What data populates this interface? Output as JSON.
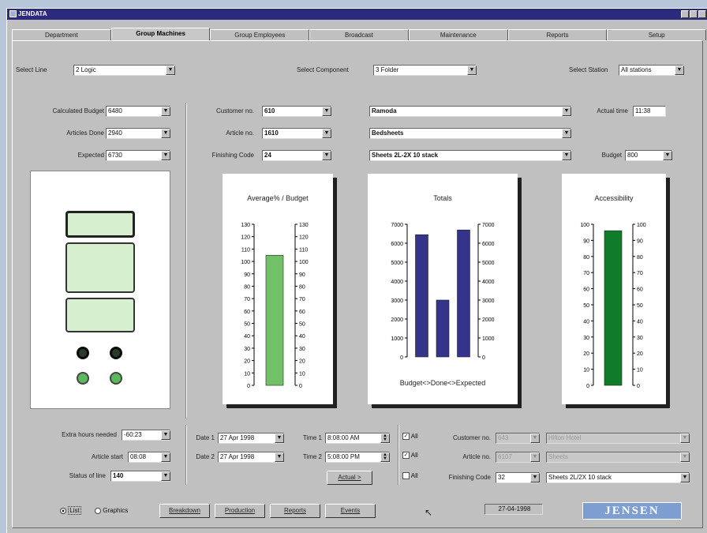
{
  "window": {
    "title": "JENDATA"
  },
  "tabs": [
    "Department",
    "Group Machines",
    "Group Employees",
    "Broadcast",
    "Maintenance",
    "Reports",
    "Setup"
  ],
  "active_tab": 1,
  "selectors": {
    "line_label": "Select Line",
    "line_value": "2 Logic",
    "component_label": "Select Component",
    "component_value": "3 Folder",
    "station_label": "Select Station",
    "station_value": "All stations"
  },
  "left_fields": {
    "calc_budget_label": "Calculated Budget",
    "calc_budget": "6480",
    "articles_done_label": "Articles Done",
    "articles_done": "2940",
    "expected_label": "Expected",
    "expected": "6730"
  },
  "middle_fields": {
    "customer_label": "Customer no.",
    "customer_no": "610",
    "customer_name": "Ramoda",
    "article_label": "Article no.",
    "article_no": "1610",
    "article_name": "Bedsheets",
    "finishing_label": "Finishing Code",
    "finishing_code": "24",
    "finishing_name": "Sheets 2L-2X 10 stack",
    "actual_time_label": "Actual time",
    "actual_time": "11:38",
    "budget_label": "Budget",
    "budget": "800"
  },
  "charts": {
    "avg": {
      "title": "Average% / Budget",
      "ticks": [
        "130",
        "120",
        "110",
        "100",
        "90",
        "80",
        "70",
        "60",
        "50",
        "40",
        "30",
        "20",
        "10",
        "0"
      ],
      "value": 105,
      "max": 130,
      "color": "#72c068"
    },
    "totals": {
      "title": "Totals",
      "ticks": [
        "7000",
        "6000",
        "5000",
        "4000",
        "3000",
        "2000",
        "1000",
        "0"
      ],
      "values": [
        6450,
        3000,
        6700
      ],
      "max": 7000,
      "color": "#33348a",
      "caption": "Budget<>Done<>Expected"
    },
    "access": {
      "title": "Accessibility",
      "ticks": [
        "100",
        "90",
        "80",
        "70",
        "60",
        "50",
        "40",
        "30",
        "20",
        "10",
        "0"
      ],
      "value": 96,
      "max": 100,
      "color": "#0f7c2a"
    }
  },
  "bottom_left": {
    "extra_hours_label": "Extra hours needed",
    "extra_hours": "-60:23",
    "article_start_label": "Article start",
    "article_start": "08:08",
    "status_label": "Status of line",
    "status": "140"
  },
  "dates": {
    "date1_label": "Date 1",
    "date1": "27 Apr 1998",
    "date2_label": "Date 2",
    "date2": "27 Apr 1998",
    "time1_label": "Time 1",
    "time1": "8:08:00 AM",
    "time2_label": "Time 2",
    "time2": "5:08:00 PM",
    "actual_btn": "Actual >"
  },
  "filters": {
    "all_label": "All",
    "customer_label": "Customer no.",
    "customer_no": "643",
    "customer_name": "Hilton Hotel",
    "article_label": "Article no.",
    "article_no": "6107",
    "article_name": "Sheets",
    "finishing_label": "Finishing Code",
    "finishing_code": "32",
    "finishing_name": "Sheets 2L/2X 10 stack"
  },
  "footer": {
    "list_label": "List",
    "graphics_label": "Graphics",
    "buttons": [
      "Breakdown",
      "Production",
      "Reports",
      "Events"
    ],
    "date": "27-04-1998",
    "logo": "JENSEN"
  }
}
